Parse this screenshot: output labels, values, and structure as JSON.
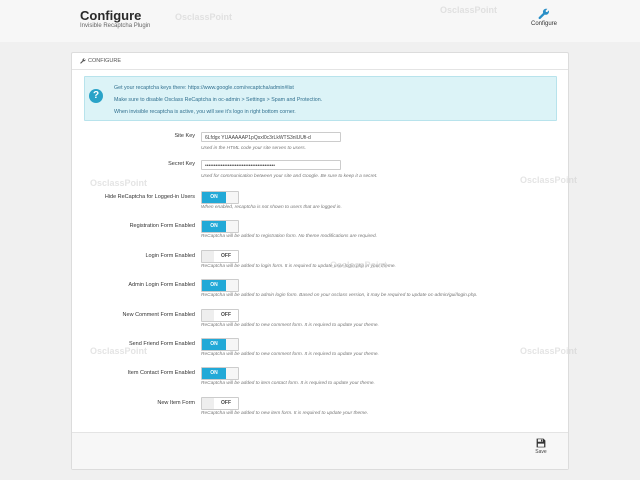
{
  "header": {
    "title": "Configure",
    "subtitle": "Invisible Recaptcha Plugin",
    "configure_label": "Configure"
  },
  "panel": {
    "heading": "CONFIGURE",
    "alert": {
      "line1": "Get your recaptcha keys there: https://www.google.com/recaptcha/admin#list",
      "line2": "Make sure to disable Osclass ReCaptcha in oc-admin > Settings > Spam and Protection.",
      "line3": "When invisible recaptcha is active, you will see it's logo in right bottom corner."
    },
    "site_key": {
      "label": "Site Key",
      "value": "6Lfdgx YUAAAAAP1pQsxl0c3rLkWTS3nlUUfi-d",
      "help": "Used in the HTML code your site serves to users."
    },
    "secret_key": {
      "label": "Secret Key",
      "value": "••••••••••••••••••••••••••••••••••••••••",
      "help": "Used for communication between your site and Google. Be sure to keep it a secret."
    },
    "toggles": [
      {
        "label": "Hide ReCaptcha for Logged-in Users",
        "state": "ON",
        "help": "When enabled, recaptcha is not shown to users that are logged in."
      },
      {
        "label": "Registration Form Enabled",
        "state": "ON",
        "help": "ReCaptcha will be added to registration form. No theme modifications are required."
      },
      {
        "label": "Login Form Enabled",
        "state": "OFF",
        "help": "ReCaptcha will be added to login form. It is required to update user-login.php in your theme."
      },
      {
        "label": "Admin Login Form Enabled",
        "state": "ON",
        "help": "ReCaptcha will be added to admin login form. Based on your osclass version, it may be required to update oc-admin/gui/login.php."
      },
      {
        "label": "New Comment Form Enabled",
        "state": "OFF",
        "help": "ReCaptcha will be added to new comment form. It is required to update your theme."
      },
      {
        "label": "Send Friend Form Enabled",
        "state": "ON",
        "help": "ReCaptcha will be added to new comment form. It is required to update your theme."
      },
      {
        "label": "Item Contact Form Enabled",
        "state": "ON",
        "help": "ReCaptcha will be added to item contact form. It is required to update your theme."
      },
      {
        "label": "New Item Form",
        "state": "OFF",
        "help": "ReCaptcha will be added to new item form. It is required to update your theme."
      }
    ]
  },
  "footer": {
    "save_label": "Save"
  },
  "watermark": "OsclassPoint",
  "colors": {
    "toggle_on": "#22a9d7",
    "alert_bg": "#dcf3f7",
    "alert_text": "#31708f"
  },
  "icons": {
    "configure": "wrench-icon",
    "save": "floppy-disk-icon",
    "info": "question-circle-icon"
  }
}
